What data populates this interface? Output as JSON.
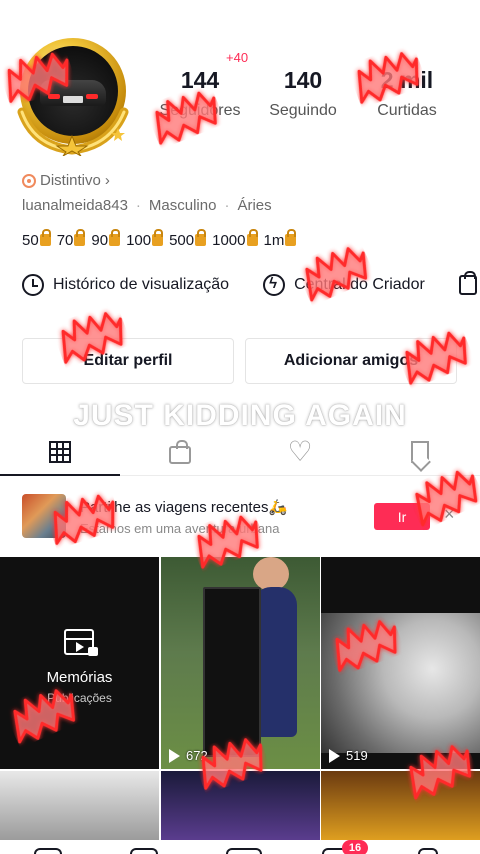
{
  "profile": {
    "stats": [
      {
        "value": "144",
        "label": "Seguidores"
      },
      {
        "value": "140",
        "label": "Seguindo"
      },
      {
        "value": "2 mil",
        "label": "Curtidas"
      }
    ],
    "followers_delta": "+40",
    "distintivo": "Distintivo",
    "username": "luanalmeida843",
    "gender": "Masculino",
    "sign": "Áries",
    "levels": [
      "50",
      "70",
      "90",
      "100",
      "500",
      "1000",
      "1m"
    ]
  },
  "links": {
    "history": "Histórico de visualização",
    "creator": "Central do Criador"
  },
  "buttons": {
    "edit": "Editar perfil",
    "add_friends": "Adicionar amigos"
  },
  "overlay_text": "JUST KIDDING AGAIN",
  "tabs": [
    "grid-icon",
    "lock-icon",
    "heart-icon",
    "bookmark-icon"
  ],
  "promo": {
    "title": "Partilhe as viagens recentes🛵",
    "subtitle": "Estamos em uma aventura urbana",
    "button": "Ir",
    "close": "×"
  },
  "videos": {
    "memories_title": "Memórias",
    "memories_subtitle": "Publicações",
    "video2_views": "672",
    "video3_views": "519"
  },
  "nav": {
    "badge": "16"
  },
  "colors": {
    "accent": "#fe2c55",
    "overlay_wing": "#ff3b3b"
  }
}
